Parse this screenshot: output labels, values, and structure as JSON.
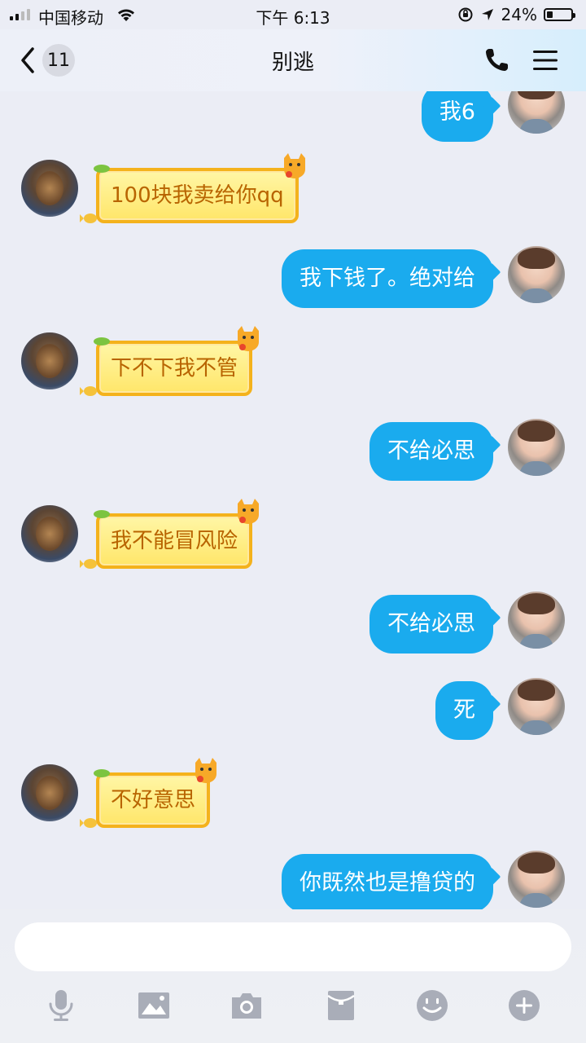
{
  "status_bar": {
    "carrier": "中国移动",
    "time": "下午 6:13",
    "battery_percent_label": "24%",
    "battery_level": 0.24
  },
  "nav": {
    "back_count": "11",
    "title": "别逃"
  },
  "messages": [
    {
      "side": "self",
      "text": "我6"
    },
    {
      "side": "other",
      "text": "100块我卖给你qq"
    },
    {
      "side": "self",
      "text": "我下钱了。绝对给"
    },
    {
      "side": "other",
      "text": "下不下我不管"
    },
    {
      "side": "self",
      "text": "不给必思"
    },
    {
      "side": "other",
      "text": "我不能冒风险"
    },
    {
      "side": "self",
      "text": "不给必思"
    },
    {
      "side": "self",
      "text": "死"
    },
    {
      "side": "other",
      "text": "不好意思"
    },
    {
      "side": "self",
      "text": "你既然也是撸贷的"
    }
  ],
  "input": {
    "placeholder": "",
    "value": ""
  },
  "toolbar": {
    "icons": [
      "microphone-icon",
      "image-icon",
      "camera-icon",
      "red-packet-icon",
      "emoji-icon",
      "plus-icon"
    ]
  },
  "colors": {
    "self_bubble": "#1aabee",
    "other_bubble_text": "#b86400",
    "icon_gray": "#a9adb8"
  }
}
